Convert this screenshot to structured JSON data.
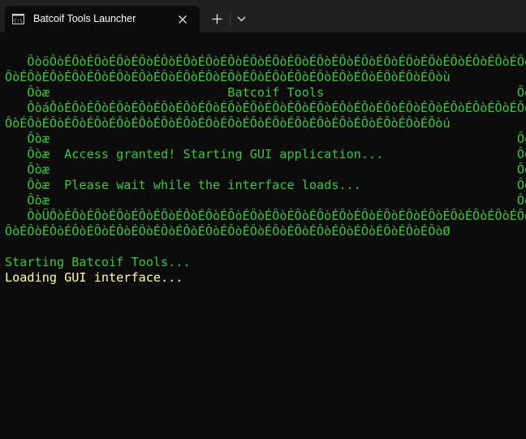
{
  "window": {
    "tab_title": "Batcoif Tools Launcher",
    "tab_icon": "terminal-icon",
    "close_icon": "close-icon",
    "new_tab_icon": "plus-icon",
    "dropdown_icon": "chevron-down-icon"
  },
  "colors": {
    "background": "#0c0c0c",
    "titlebar": "#202020",
    "green": "#3ec63e",
    "yellow": "#ffffa8"
  },
  "terminal": {
    "lines": [
      "",
      "   ÔòöÔòÉÔòÉÔòÉÔòÉÔòÉÔòÉÔòÉÔòÉÔòÉÔòÉÔòÉÔòÉÔòÉÔòÉÔòÉÔòÉÔòÉÔòÉÔòÉÔòÉÔòÉÔòÉÔòÉÔòÉÔòÉÔòÉÔò",
      "ÔòÉÔòÉÔòÉÔòÉÔòÉÔòÉÔòÉÔòÉÔòÉÔòÉÔòÉÔòÉÔòÉÔòÉÔòÉÔòÉÔòÉÔòÉÔòÉÔòù",
      "   Ôòæ                        Batcoif Tools                          Ôòæ",
      "   ÔòáÔòÉÔòÉÔòÉÔòÉÔòÉÔòÉÔòÉÔòÉÔòÉÔòÉÔòÉÔòÉÔòÉÔòÉÔòÉÔòÉÔòÉÔòÉÔòÉÔòÉÔòÉÔòÉÔòÉÔòÉÔòÉÔòÉÔò",
      "ÔòÉÔòÉÔòÉÔòÉÔòÉÔòÉÔòÉÔòÉÔòÉÔòÉÔòÉÔòÉÔòÉÔòÉÔòÉÔòÉÔòÉÔòÉÔòÉÔòú",
      "   Ôòæ                                                               Ôòæ",
      "   Ôòæ  Access granted! Starting GUI application...                  Ôòæ",
      "   Ôòæ                                                               Ôòæ",
      "   Ôòæ  Please wait while the interface loads...                     Ôòæ",
      "   Ôòæ                                                               Ôòæ",
      "   ÔòÜÔòÉÔòÉÔòÉÔòÉÔòÉÔòÉÔòÉÔòÉÔòÉÔòÉÔòÉÔòÉÔòÉÔòÉÔòÉÔòÉÔòÉÔòÉÔòÉÔòÉÔòÉÔòÉÔòÉÔòÉÔòÉÔòÉÔò",
      "ÔòÉÔòÉÔòÉÔòÉÔòÉÔòÉÔòÉÔòÉÔòÉÔòÉÔòÉÔòÉÔòÉÔòÉÔòÉÔòÉÔòÉÔòÉÔòÉÔòØ",
      "",
      "Starting Batcoif Tools...",
      "Loading GUI interface..."
    ]
  }
}
